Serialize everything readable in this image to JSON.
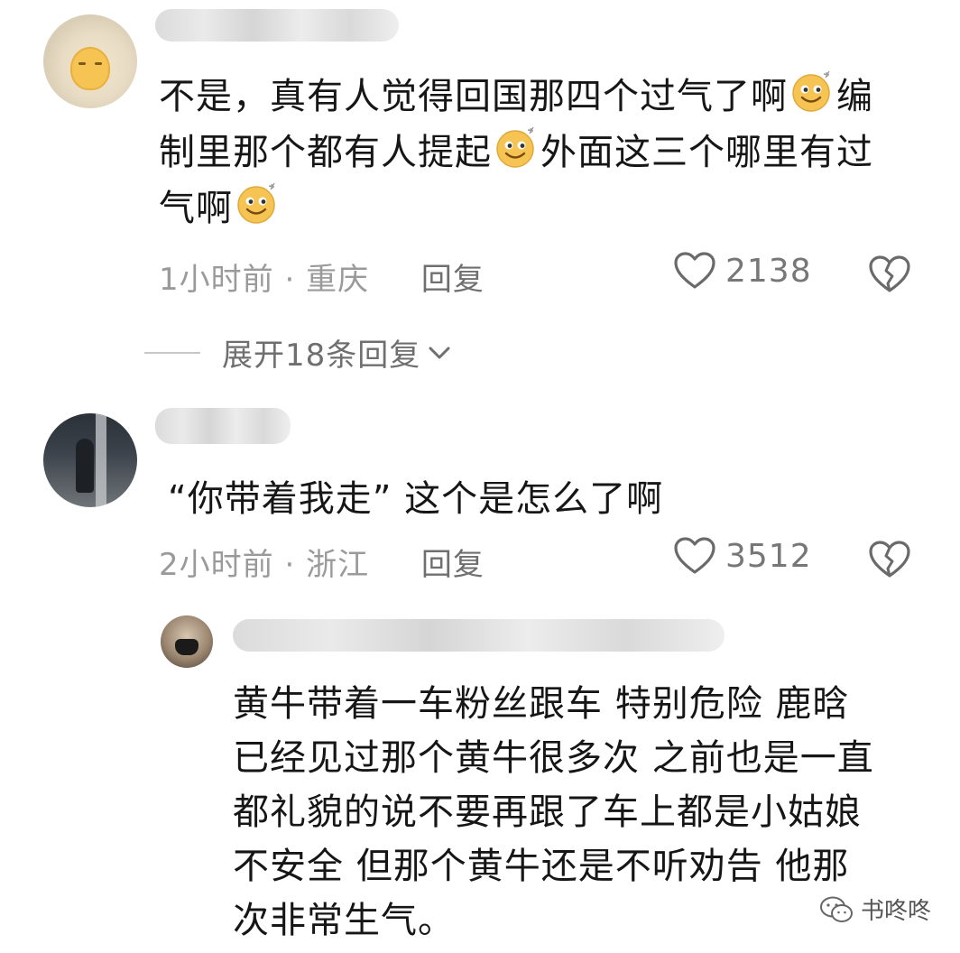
{
  "comments": [
    {
      "username_blurred": true,
      "text_lines": [
        [
          "不是，真有人觉得回国那四个过气了啊",
          "[emoji]",
          "编"
        ],
        [
          "制里那个都有人提起",
          "[emoji]",
          "外面这三个哪里有过"
        ],
        [
          "气啊",
          "[emoji]"
        ]
      ],
      "time": "1小时前",
      "location": "重庆",
      "reply_label": "回复",
      "likes": "2138",
      "expand_label": "展开18条回复"
    },
    {
      "username_blurred": true,
      "text": "“你带着我走” 这个是怎么了啊",
      "time": "2小时前",
      "location": "浙江",
      "reply_label": "回复",
      "likes": "3512"
    }
  ],
  "reply": {
    "username_blurred": true,
    "text_lines": [
      "黄牛带着一车粉丝跟车 特别危险 鹿晗",
      "已经见过那个黄牛很多次 之前也是一直",
      "都礼貌的说不要再跟了车上都是小姑娘",
      "不安全 但那个黄牛还是不听劝告 他那",
      "次非常生气。"
    ]
  },
  "icons": {
    "like": "heart-outline-icon",
    "dislike": "broken-heart-icon",
    "expand": "chevron-down-icon",
    "emoji": "smile-emoji-icon",
    "watermark": "wechat-icon"
  },
  "watermark": {
    "text": "书咚咚"
  },
  "colors": {
    "text": "#161616",
    "meta": "#9a9a9a",
    "reply_link": "#6f6f6f",
    "emoji": "#f6c453"
  }
}
